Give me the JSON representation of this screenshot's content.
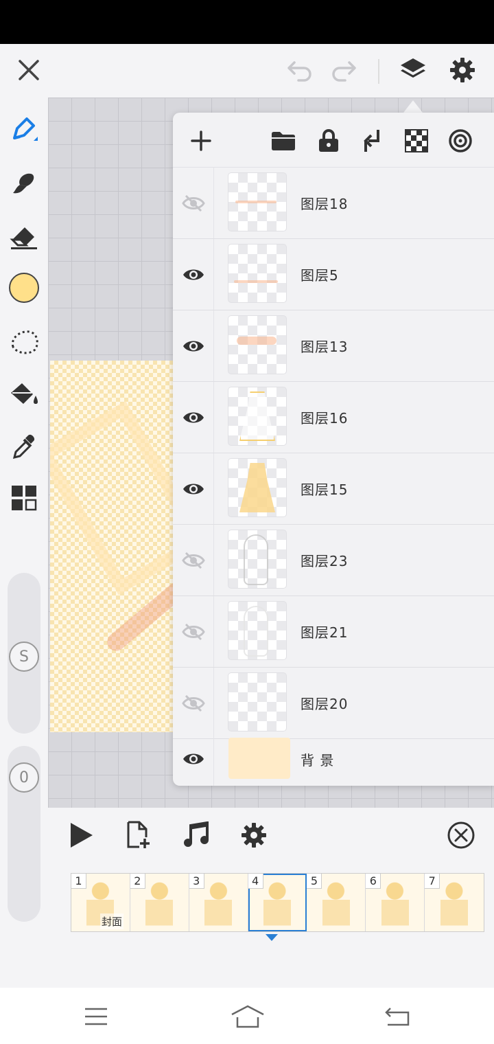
{
  "icons": {
    "close": "close-icon",
    "undo": "undo-icon",
    "redo": "redo-icon",
    "layers": "layers-icon",
    "settings": "gear-icon"
  },
  "tools": [
    "pen-icon",
    "brush-icon",
    "eraser-icon",
    "color-swatch",
    "lasso-icon",
    "fill-bucket-icon",
    "eyedropper-icon",
    "grid-tiles-icon"
  ],
  "colors": {
    "accent": "#1a7ee6",
    "current_color": "#ffe08a",
    "frame_selected": "#2a7fd4",
    "background_layer": "#ffebc8"
  },
  "sliders": {
    "size_label": "S",
    "opacity_label": "0"
  },
  "layers_panel": {
    "toolbar": [
      "add-icon",
      "folder-icon",
      "lock-icon",
      "merge-down-icon",
      "checker-icon",
      "target-icon"
    ],
    "layers": [
      {
        "name": "图层18",
        "visible": false
      },
      {
        "name": "图层5",
        "visible": true
      },
      {
        "name": "图层13",
        "visible": true
      },
      {
        "name": "图层16",
        "visible": true
      },
      {
        "name": "图层15",
        "visible": true
      },
      {
        "name": "图层23",
        "visible": false
      },
      {
        "name": "图层21",
        "visible": false
      },
      {
        "name": "图层20",
        "visible": false
      },
      {
        "name": "背 景",
        "visible": true
      }
    ]
  },
  "animation": {
    "controls": [
      "play-icon",
      "add-frame-icon",
      "music-icon",
      "gear-icon",
      "close-circle-icon"
    ],
    "frames": [
      {
        "num": "1",
        "label": "封面"
      },
      {
        "num": "2",
        "label": ""
      },
      {
        "num": "3",
        "label": ""
      },
      {
        "num": "4",
        "label": "",
        "selected": true
      },
      {
        "num": "5",
        "label": ""
      },
      {
        "num": "6",
        "label": ""
      },
      {
        "num": "7",
        "label": ""
      }
    ]
  },
  "navigation": [
    "menu-icon",
    "home-icon",
    "back-icon"
  ]
}
